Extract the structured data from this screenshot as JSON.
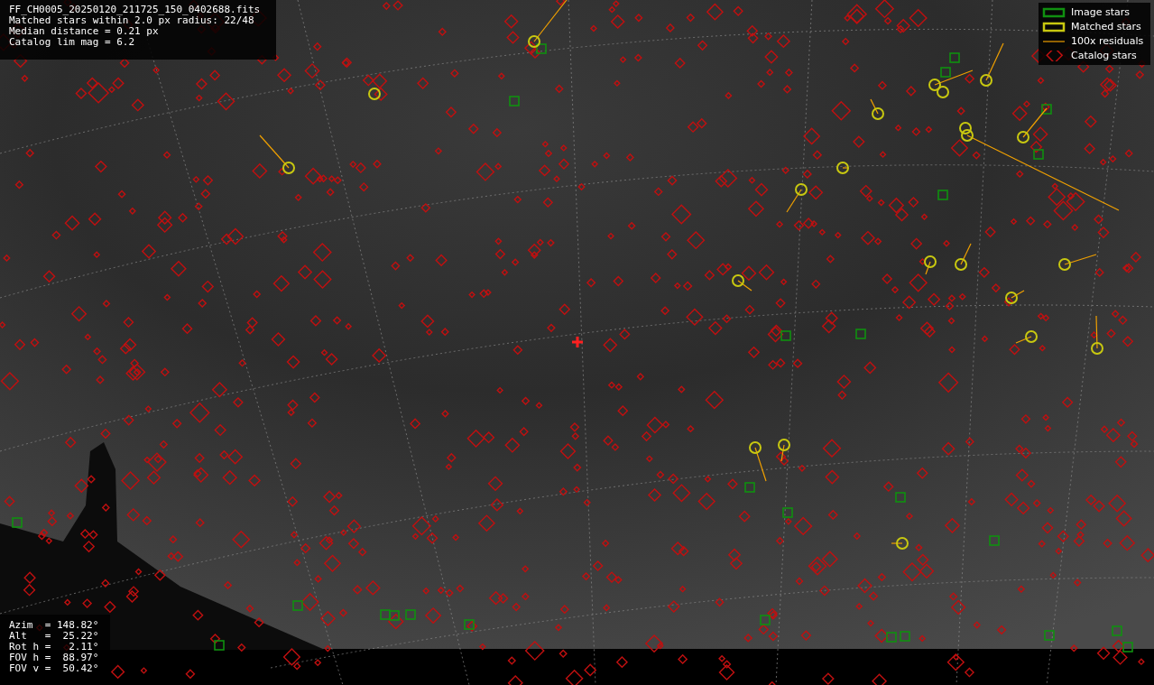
{
  "info_box": {
    "lines": [
      "FF_CH0005_20250120_211725_150_0402688.fits",
      "Matched stars within 2.0 px radius: 22/48",
      "Median distance = 0.21 px",
      "Catalog lim mag = 6.2"
    ]
  },
  "legend": [
    {
      "kind": "image",
      "label": "Image stars"
    },
    {
      "kind": "matched",
      "label": "Matched stars"
    },
    {
      "kind": "residual",
      "label": "100x residuals"
    },
    {
      "kind": "catalog",
      "label": "Catalog stars"
    }
  ],
  "pointing": {
    "lines": [
      "Azim  = 148.82°",
      "Alt   =  25.22°",
      "Rot h =   2.11°",
      "FOV h =  88.97°",
      "FOV v =  50.42°"
    ]
  }
}
